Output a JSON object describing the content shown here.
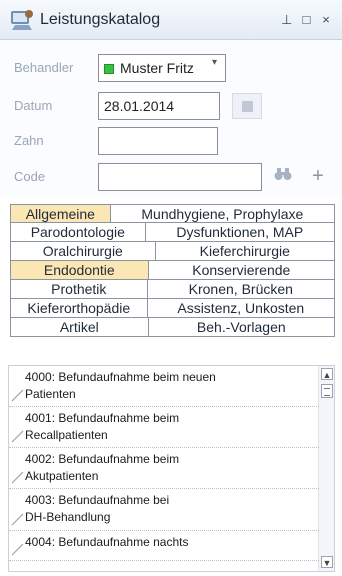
{
  "window": {
    "title": "Leistungskatalog",
    "buttons": {
      "pin": "⊥",
      "maximize": "□",
      "close": "×"
    }
  },
  "form": {
    "behandler_label": "Behandler",
    "behandler_value": "Muster Fritz",
    "datum_label": "Datum",
    "datum_value": "28.01.2014",
    "zahn_label": "Zahn",
    "zahn_value": "",
    "code_label": "Code",
    "code_value": ""
  },
  "tabs": [
    [
      {
        "label": "Allgemeine",
        "active": true
      },
      {
        "label": "Mundhygiene, Prophylaxe",
        "active": false
      }
    ],
    [
      {
        "label": "Parodontologie",
        "active": false
      },
      {
        "label": "Dysfunktionen, MAP",
        "active": false
      }
    ],
    [
      {
        "label": "Oralchirurgie",
        "active": false
      },
      {
        "label": "Kieferchirurgie",
        "active": false
      }
    ],
    [
      {
        "label": "Endodontie",
        "active": true
      },
      {
        "label": "Konservierende",
        "active": false
      }
    ],
    [
      {
        "label": "Prothetik",
        "active": false
      },
      {
        "label": "Kronen, Brücken",
        "active": false
      }
    ],
    [
      {
        "label": "Kieferorthopädie",
        "active": false
      },
      {
        "label": "Assistenz, Unkosten",
        "active": false
      }
    ],
    [
      {
        "label": "Artikel",
        "active": false
      },
      {
        "label": "Beh.-Vorlagen",
        "active": false
      }
    ]
  ],
  "list": {
    "items": [
      {
        "line1": "4000: Befundaufnahme beim neuen",
        "line2": "Patienten"
      },
      {
        "line1": "4001: Befundaufnahme beim",
        "line2": "Recallpatienten"
      },
      {
        "line1": "4002: Befundaufnahme beim",
        "line2": "Akutpatienten"
      },
      {
        "line1": "4003: Befundaufnahme bei",
        "line2": "DH-Behandlung"
      },
      {
        "line1": "4004: Befundaufnahme nachts",
        "line2": ""
      }
    ],
    "scroll_up": "▲",
    "scroll_down": "▼"
  },
  "colors": {
    "active_tab": "#fbe7b3",
    "accent_green": "#35c33f"
  }
}
